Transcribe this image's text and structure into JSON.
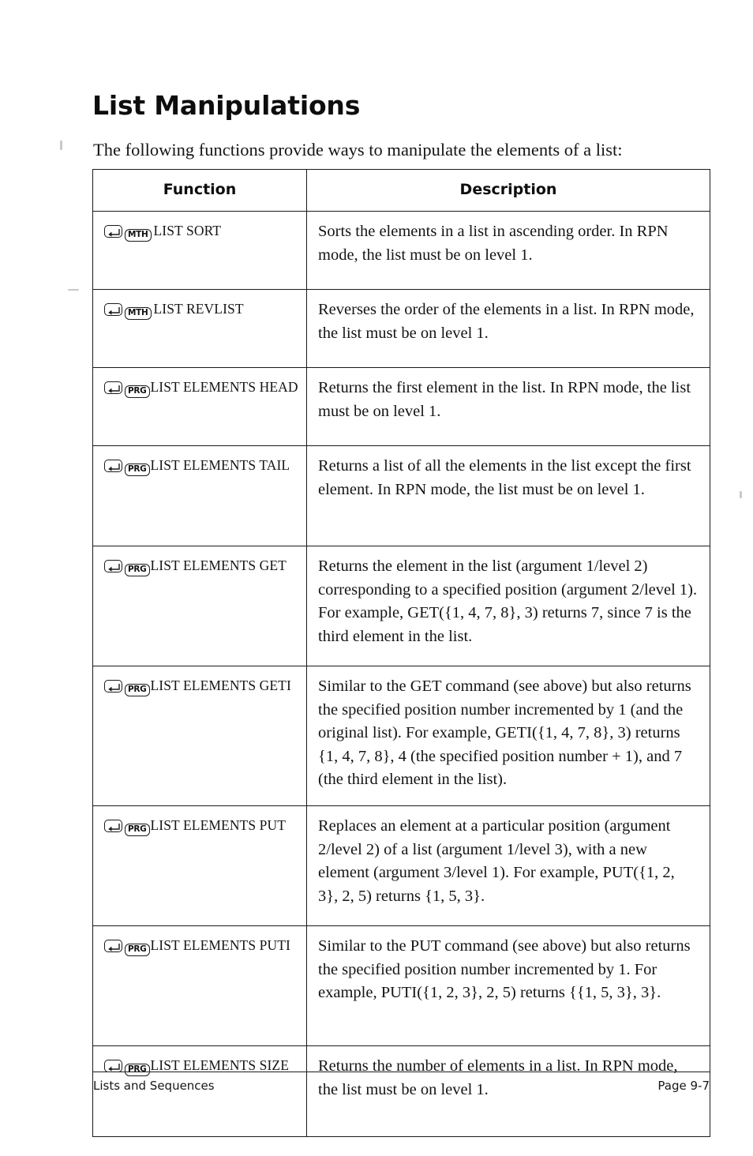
{
  "document": {
    "title": "List Manipulations",
    "intro": "The following functions provide ways to manipulate the elements of a list:"
  },
  "table": {
    "headers": {
      "function": "Function",
      "description": "Description"
    },
    "rows": [
      {
        "menu_key": "MTH",
        "shift_icon": "left-shift-key-icon",
        "command": "LIST SORT",
        "description": "Sorts the elements in a list in ascending order. In RPN mode, the list must be on level 1."
      },
      {
        "menu_key": "MTH",
        "shift_icon": "left-shift-key-icon",
        "command": "LIST REVLIST",
        "description": "Reverses the order of the elements in a list. In RPN mode, the list must be on level 1."
      },
      {
        "menu_key": "PRG",
        "shift_icon": "left-shift-key-icon",
        "command": "LIST ELEMENTS HEAD",
        "description": "Returns the first element in the list. In RPN mode, the list must be on level 1."
      },
      {
        "menu_key": "PRG",
        "shift_icon": "left-shift-key-icon",
        "command": "LIST ELEMENTS TAIL",
        "description": "Returns a list of all the elements in the list except the first element. In RPN mode, the list must be on level 1."
      },
      {
        "menu_key": "PRG",
        "shift_icon": "left-shift-key-icon",
        "command": "LIST ELEMENTS GET",
        "description": "Returns the element in the list (argument 1/level 2) corresponding to a specified position (argument 2/level 1). For example, GET({1, 4, 7, 8}, 3) returns 7, since 7 is the third element in the list."
      },
      {
        "menu_key": "PRG",
        "shift_icon": "left-shift-key-icon",
        "command": "LIST ELEMENTS GETI",
        "description": "Similar to the GET command (see above) but also returns the specified position number incremented by 1 (and the original list). For example, GETI({1, 4, 7, 8}, 3) returns {1, 4, 7, 8}, 4 (the specified position number + 1), and 7 (the third element in the list)."
      },
      {
        "menu_key": "PRG",
        "shift_icon": "left-shift-key-icon",
        "command": "LIST ELEMENTS PUT",
        "description": "Replaces an element at a particular position (argument 2/level 2) of a list (argument 1/level 3), with a new element (argument 3/level 1). For example, PUT({1, 2, 3}, 2, 5) returns {1, 5, 3}."
      },
      {
        "menu_key": "PRG",
        "shift_icon": "left-shift-key-icon",
        "command": "LIST ELEMENTS PUTI",
        "description": "Similar to the PUT command (see above) but also returns the specified position number incremented by 1. For example, PUTI({1, 2, 3}, 2, 5) returns {{1, 5, 3}, 3}."
      },
      {
        "menu_key": "PRG",
        "shift_icon": "left-shift-key-icon",
        "command": "LIST ELEMENTS SIZE",
        "description": "Returns the number of elements in a list. In RPN mode, the list must be on level 1."
      }
    ]
  },
  "footer": {
    "left": "Lists and Sequences",
    "right": "Page 9-7"
  },
  "colors": {
    "text": "#141414",
    "rule": "#1a1a1a",
    "background": "#ffffff"
  }
}
